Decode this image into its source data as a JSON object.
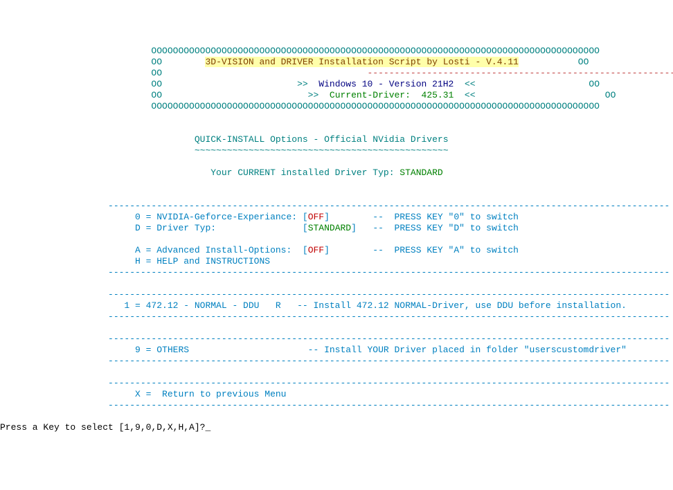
{
  "header": {
    "border_top": "                            OOOOOOOOOOOOOOOOOOOOOOOOOOOOOOOOOOOOOOOOOOOOOOOOOOOOOOOOOOOOOOOOOOOOOOOOOOOOOOOOOOO",
    "oo": "                            OO",
    "oo_right": "OO",
    "title": "3D-VISION and DRIVER Installation Script by Losti - V.4.11",
    "title_underline": "                                      ----------------------------------------------------------",
    "line2_pad": "                                                                                                           ",
    "os_pre": "                                                       >>  ",
    "os": "Windows 10 - Version 21H2",
    "os_post": "  <<                       ",
    "drv_pre": "                                                         >>  ",
    "drv_label": "Current-Driver:  ",
    "drv_ver": "425.31",
    "drv_post": "  <<                          ",
    "border_bot": "                            OOOOOOOOOOOOOOOOOOOOOOOOOOOOOOOOOOOOOOOOOOOOOOOOOOOOOOOOOOOOOOOOOOOOOOOOOOOOOOOOOOO"
  },
  "section": {
    "quick_title": "                                    QUICK-INSTALL Options - Official NVidia Drivers",
    "quick_wave": "                                    ~~~~~~~~~~~~~~~~~~~~~~~~~~~~~~~~~~~~~~~~~~~~~~~",
    "cur_label": "                                       Your CURRENT installed Driver Typ: ",
    "cur_val": "STANDARD"
  },
  "dash": "                    --------------------------------------------------------------------------------------------------------",
  "opt": {
    "o0_pre": "                         0 = NVIDIA-Geforce-Experiance: [",
    "o0_val": "OFF",
    "o0_post": "]        --  PRESS KEY \"0\" to switch",
    "od_pre": "                         D = Driver Typ:                [",
    "od_val": "STANDARD",
    "od_post": "]   --  PRESS KEY \"D\" to switch",
    "oa_pre": "                         A = Advanced Install-Options:  [",
    "oa_val": "OFF",
    "oa_post": "]        --  PRESS KEY \"A\" to switch",
    "oh": "                         H = HELP and INSTRUCTIONS",
    "o1": "                       1 = 472.12 - NORMAL - DDU   R   -- Install 472.12 NORMAL-Driver, use DDU before installation.",
    "o9": "                         9 = OTHERS                      -- Install YOUR Driver placed in folder \"userscustomdriver\"",
    "ox": "                         X =  Return to previous Menu"
  },
  "prompt": {
    "text": "Press a Key to select [1,9,0,D,X,H,A]?",
    "cursor": "_"
  }
}
